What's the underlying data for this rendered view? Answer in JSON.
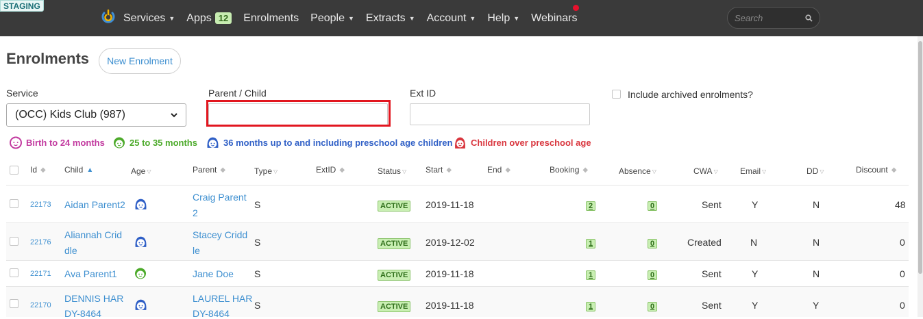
{
  "nav": {
    "staging": "STAGING",
    "items": [
      {
        "label": "Services",
        "caret": true
      },
      {
        "label": "Apps",
        "badge": "12"
      },
      {
        "label": "Enrolments"
      },
      {
        "label": "People",
        "caret": true
      },
      {
        "label": "Extracts",
        "caret": true
      },
      {
        "label": "Account",
        "caret": true
      },
      {
        "label": "Help",
        "caret": true
      },
      {
        "label": "Webinars"
      }
    ],
    "search_placeholder": "Search"
  },
  "page": {
    "title": "Enrolments",
    "new_button": "New Enrolment"
  },
  "filters": {
    "service_label": "Service",
    "service_value": "(OCC) Kids Club (987)",
    "parent_label": "Parent / Child",
    "parent_value": "",
    "extid_label": "Ext ID",
    "extid_value": "",
    "archived_label": "Include archived enrolments?"
  },
  "legend": {
    "birth": "Birth to 24 months",
    "toddler": "25 to 35 months",
    "preschool": "36 months up to and including preschool age children",
    "over": "Children over preschool age",
    "colors": {
      "birth": "#c23a9f",
      "toddler": "#4caa2a",
      "preschool": "#2f5fc6",
      "over": "#d9363e"
    }
  },
  "table": {
    "headers": {
      "id": "Id",
      "child": "Child",
      "age": "Age",
      "parent": "Parent",
      "type": "Type",
      "extid": "ExtID",
      "status": "Status",
      "start": "Start",
      "end": "End",
      "booking": "Booking",
      "absence": "Absence",
      "cwa": "CWA",
      "email": "Email",
      "dd": "DD",
      "discount": "Discount"
    },
    "rows": [
      {
        "id": "22173",
        "child_1": "Aidan Parent2",
        "child_2": "",
        "age_icon": "preschool-child-icon",
        "parent_1": "Craig Parent",
        "parent_2": "2",
        "type": "S",
        "status": "ACTIVE",
        "start": "2019-11-18",
        "booking": "2",
        "absence": "0",
        "cwa": "Sent",
        "email": "Y",
        "dd": "N",
        "discount": "48"
      },
      {
        "id": "22176",
        "child_1": "Aliannah Crid",
        "child_2": "dle",
        "age_icon": "preschool-child-icon",
        "parent_1": "Stacey Cridd",
        "parent_2": "le",
        "type": "S",
        "status": "ACTIVE",
        "start": "2019-12-02",
        "booking": "1",
        "absence": "0",
        "cwa": "Created",
        "email": "N",
        "dd": "N",
        "discount": "0"
      },
      {
        "id": "22171",
        "child_1": "Ava Parent1",
        "child_2": "",
        "age_icon": "toddler-icon",
        "parent_1": "Jane Doe",
        "parent_2": "",
        "type": "S",
        "status": "ACTIVE",
        "start": "2019-11-18",
        "booking": "1",
        "absence": "0",
        "cwa": "Sent",
        "email": "Y",
        "dd": "N",
        "discount": "0"
      },
      {
        "id": "22170",
        "child_1": "DENNIS HAR",
        "child_2": "DY-8464",
        "age_icon": "preschool-child-icon",
        "parent_1": "LAUREL HAR",
        "parent_2": "DY-8464",
        "type": "S",
        "status": "ACTIVE",
        "start": "2019-11-18",
        "booking": "1",
        "absence": "0",
        "cwa": "Sent",
        "email": "Y",
        "dd": "Y",
        "discount": "0"
      }
    ]
  }
}
